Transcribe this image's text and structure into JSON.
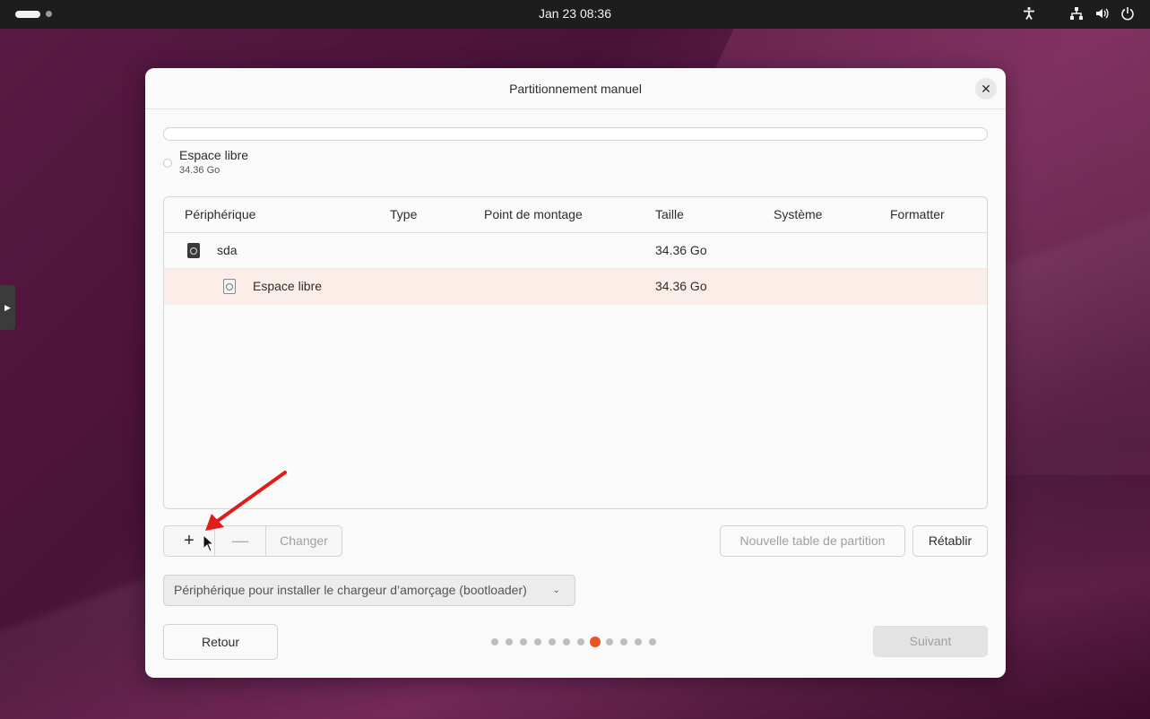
{
  "topbar": {
    "clock": "Jan 23  08:36",
    "icons": [
      "accessibility-icon",
      "network-icon",
      "volume-icon",
      "power-icon"
    ]
  },
  "dialog": {
    "title": "Partitionnement manuel",
    "close_icon": "close-icon",
    "usage_legend": {
      "name": "Espace libre",
      "size": "34.36 Go"
    },
    "table": {
      "headers": [
        "Périphérique",
        "Type",
        "Point de montage",
        "Taille",
        "Système",
        "Formatter"
      ],
      "rows": [
        {
          "device": "sda",
          "type": "",
          "mount": "",
          "size": "34.36 Go",
          "system": "",
          "format": ""
        },
        {
          "device": "Espace libre",
          "type": "",
          "mount": "",
          "size": "34.36 Go",
          "system": "",
          "format": ""
        }
      ]
    },
    "buttons": {
      "add": "+",
      "remove": "—",
      "change": "Changer",
      "new_table": "Nouvelle table de partition",
      "reset": "Rétablir",
      "back": "Retour",
      "next": "Suivant"
    },
    "bootloader": {
      "label": "Périphérique pour installer le chargeur d’amorçage (bootloader)"
    },
    "progress": {
      "total_steps": 12,
      "current_step": 8
    }
  },
  "colors": {
    "accent": "#e95420",
    "topbar": "#1d1d1d",
    "dialog_bg": "#fafafa",
    "selected_row": "#fbeee9",
    "annotation_arrow": "#e01b1b"
  }
}
